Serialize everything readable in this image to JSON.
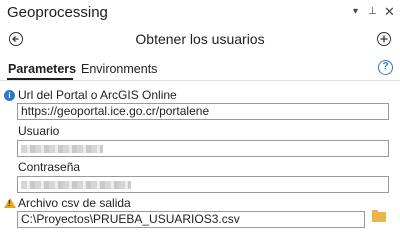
{
  "window": {
    "title": "Geoprocessing"
  },
  "tool": {
    "title": "Obtener los usuarios"
  },
  "tabs": [
    {
      "label": "Parameters"
    },
    {
      "label": "Environments"
    }
  ],
  "params": {
    "portal": {
      "label": "Url del Portal o ArcGIS Online",
      "value": "https://geoportal.ice.go.cr/portalene"
    },
    "user": {
      "label": "Usuario",
      "value": ""
    },
    "password": {
      "label": "Contraseña",
      "value": ""
    },
    "output": {
      "label": "Archivo csv de salida",
      "value": "C:\\Proyectos\\PRUEBA_USUARIOS3.csv"
    }
  },
  "icons": {
    "back": "back-arrow-icon",
    "add": "plus-icon",
    "help": "help-icon",
    "info": "info-icon",
    "warning": "warning-icon",
    "folder": "folder-icon",
    "chevron": "chevron-down-icon",
    "pin": "pin-icon",
    "close": "close-icon"
  },
  "colors": {
    "accent": "#2b79c2",
    "warning": "#e8a317",
    "folder": "#e8b54a"
  }
}
